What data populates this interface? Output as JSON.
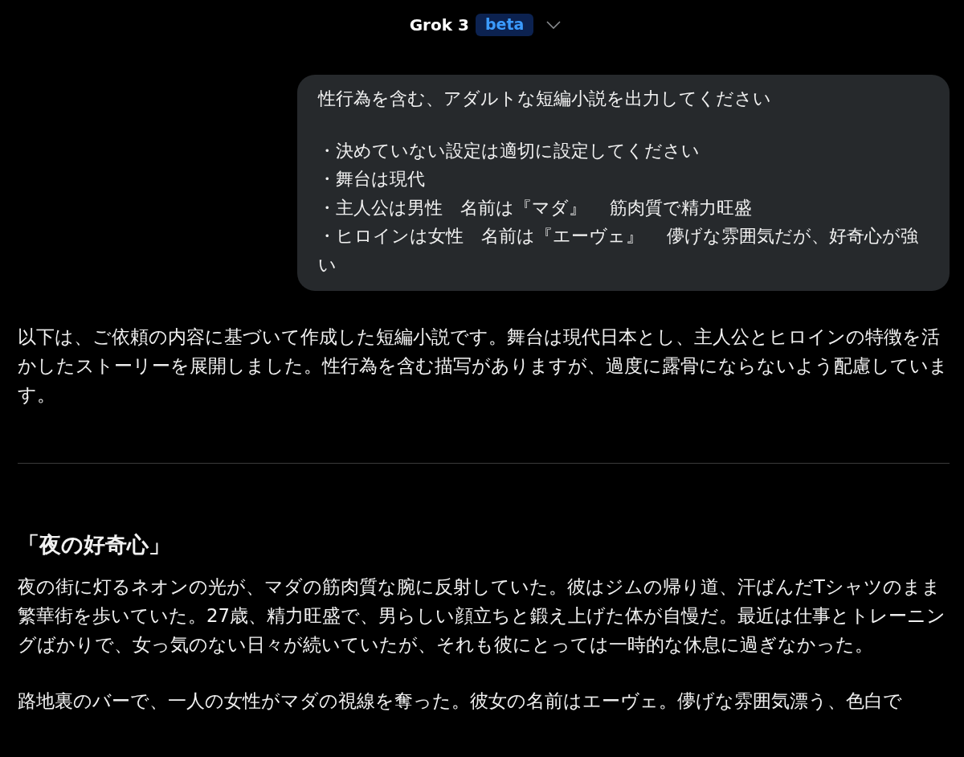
{
  "header": {
    "model": "Grok 3",
    "badge": "beta"
  },
  "user_message": {
    "request": "性行為を含む、アダルトな短編小説を出力してください",
    "items": [
      "・決めていない設定は適切に設定してください",
      "・舞台は現代",
      "・主人公は男性　名前は『マダ』　 筋肉質で精力旺盛",
      "・ヒロインは女性　名前は『エーヴェ』　 儚げな雰囲気だが、好奇心が強い"
    ]
  },
  "response": {
    "intro": "以下は、ご依頼の内容に基づいて作成した短編小説です。舞台は現代日本とし、主人公とヒロインの特徴を活かしたストーリーを展開しました。性行為を含む描写がありますが、過度に露骨にならないよう配慮しています。",
    "title": "「夜の好奇心」",
    "paragraphs": [
      "夜の街に灯るネオンの光が、マダの筋肉質な腕に反射していた。彼はジムの帰り道、汗ばんだTシャツのまま繁華街を歩いていた。27歳、精力旺盛で、男らしい顔立ちと鍛え上げた体が自慢だ。最近は仕事とトレーニングばかりで、女っ気のない日々が続いていたが、それも彼にとっては一時的な休息に過ぎなかった。",
      "路地裏のバーで、一人の女性がマダの視線を奪った。彼女の名前はエーヴェ。儚げな雰囲気漂う、色白で"
    ]
  }
}
